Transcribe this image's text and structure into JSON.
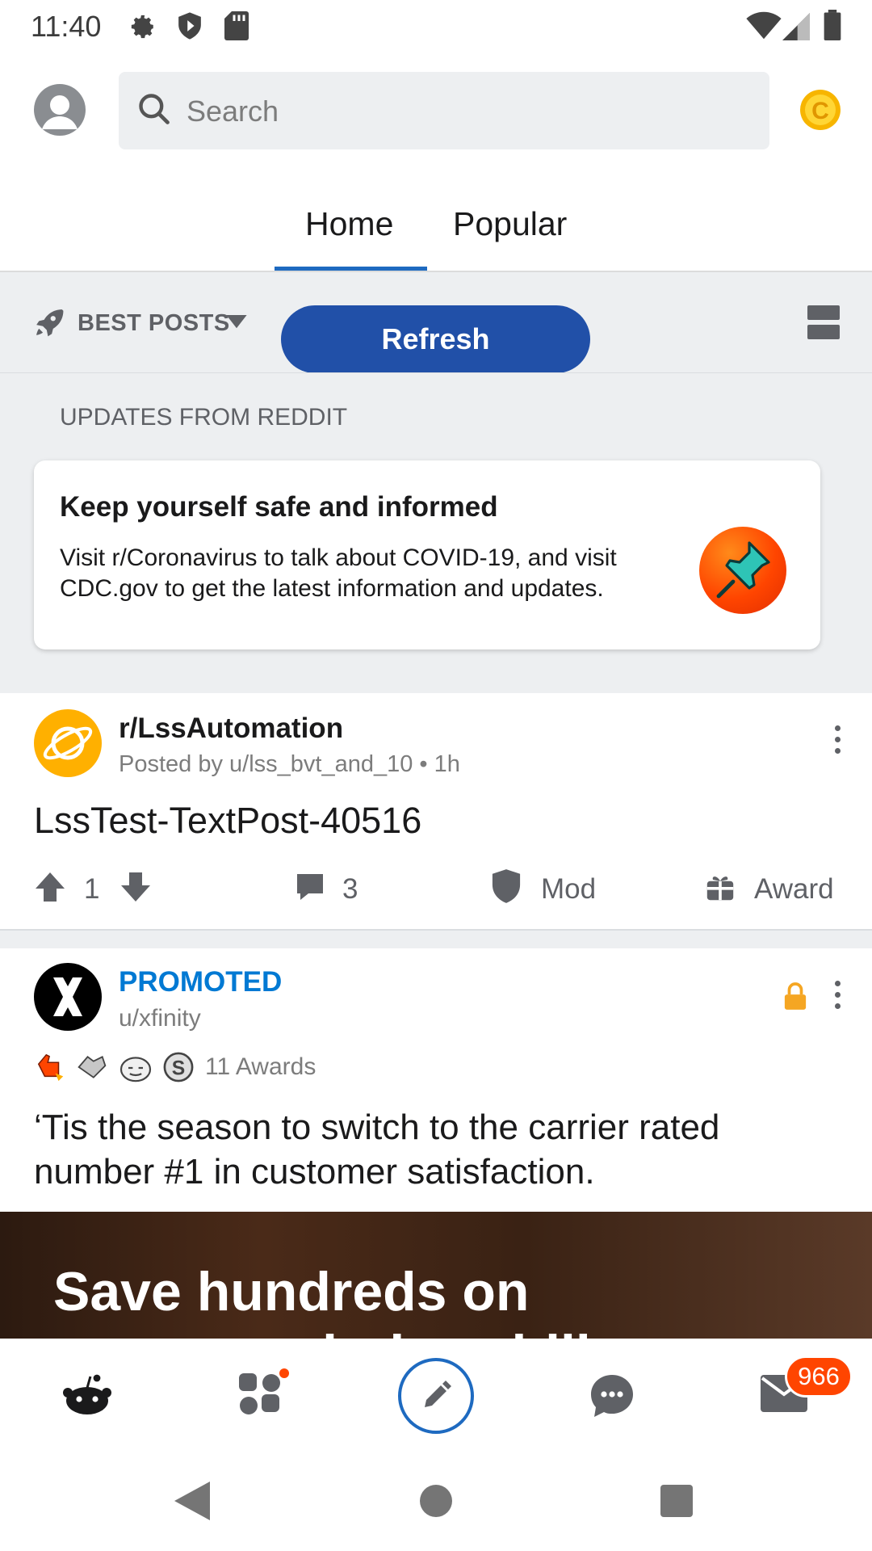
{
  "status_bar": {
    "time": "11:40"
  },
  "search": {
    "placeholder": "Search"
  },
  "tabs": [
    {
      "label": "Home",
      "active": true
    },
    {
      "label": "Popular",
      "active": false
    }
  ],
  "sort": {
    "label": "BEST POSTS",
    "refresh_label": "Refresh"
  },
  "updates": {
    "section_title": "UPDATES FROM REDDIT",
    "card_title": "Keep yourself safe and informed",
    "card_body": "Visit r/Coronavirus to talk about COVID-19, and visit CDC.gov to get the latest information and updates."
  },
  "post1": {
    "subreddit": "r/LssAutomation",
    "meta": "Posted by u/lss_bvt_and_10 • 1h",
    "title": "LssTest-TextPost-40516",
    "score": "1",
    "comments": "3",
    "mod_label": "Mod",
    "award_label": "Award"
  },
  "post2": {
    "promoted_label": "PROMOTED",
    "user": "u/xfinity",
    "awards": "11 Awards",
    "title": "‘Tis the season to switch to the carrier rated number #1 in customer satisfaction.",
    "ad_headline": "Save hundreds on",
    "ad_headline_cut": "your wireless bill"
  },
  "bottom_nav": {
    "inbox_badge": "966"
  },
  "colors": {
    "accent_blue": "#1e6ac0",
    "refresh_blue": "#2150a8",
    "orangered": "#ff4500",
    "promoted_blue": "#0079d3"
  },
  "icons": [
    "settings-icon",
    "shield-icon",
    "sd-card-icon",
    "wifi-icon",
    "signal-icon",
    "battery-icon",
    "avatar-icon",
    "search-icon",
    "coin-icon",
    "rocket-icon",
    "chevron-down-icon",
    "card-view-icon",
    "pin-icon",
    "planet-icon",
    "kebab-icon",
    "upvote-icon",
    "downvote-icon",
    "comment-icon",
    "mod-shield-icon",
    "gift-icon",
    "lock-icon",
    "xfinity-logo",
    "snoo-icon",
    "communities-icon",
    "create-icon",
    "chat-icon",
    "mail-icon",
    "back-icon",
    "home-circle-icon",
    "recents-icon"
  ]
}
